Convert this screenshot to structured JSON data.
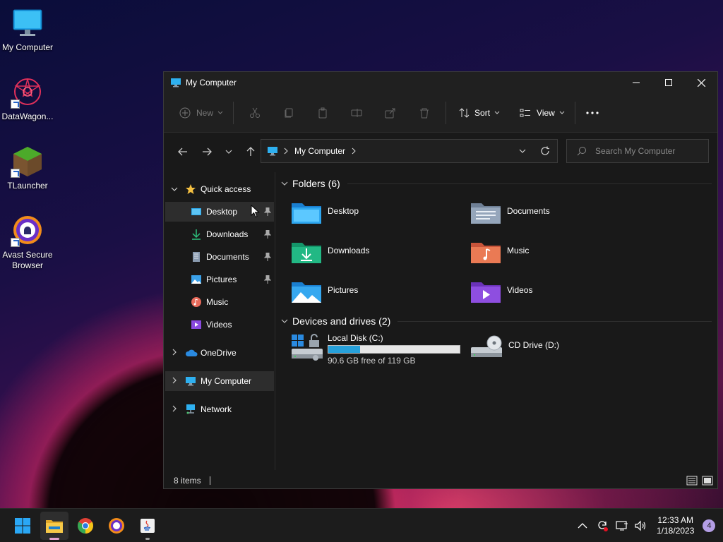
{
  "desktop": {
    "icons": [
      {
        "label": "My Computer"
      },
      {
        "label": "DataWagon..."
      },
      {
        "label": "TLauncher"
      },
      {
        "label": "Avast Secure Browser"
      }
    ]
  },
  "window": {
    "title": "My Computer",
    "toolbar": {
      "new_label": "New",
      "sort_label": "Sort",
      "view_label": "View"
    },
    "address": {
      "path": "My Computer"
    },
    "search": {
      "placeholder": "Search My Computer"
    },
    "sidebar": {
      "quick_access": "Quick access",
      "items": [
        {
          "label": "Desktop",
          "pinned": true
        },
        {
          "label": "Downloads",
          "pinned": true
        },
        {
          "label": "Documents",
          "pinned": true
        },
        {
          "label": "Pictures",
          "pinned": true
        },
        {
          "label": "Music",
          "pinned": false
        },
        {
          "label": "Videos",
          "pinned": false
        }
      ],
      "onedrive": "OneDrive",
      "my_computer": "My Computer",
      "network": "Network"
    },
    "content": {
      "folders_header": "Folders (6)",
      "folders": [
        {
          "label": "Desktop"
        },
        {
          "label": "Documents"
        },
        {
          "label": "Downloads"
        },
        {
          "label": "Music"
        },
        {
          "label": "Pictures"
        },
        {
          "label": "Videos"
        }
      ],
      "drives_header": "Devices and drives (2)",
      "drives": [
        {
          "label": "Local Disk (C:)",
          "free_text": "90.6 GB free of 119 GB",
          "used_fraction": 0.24
        },
        {
          "label": "CD Drive (D:)"
        }
      ]
    },
    "status": {
      "items_text": "8 items"
    }
  },
  "taskbar": {
    "time": "12:33 AM",
    "date": "1/18/2023",
    "notification_count": "4"
  },
  "colors": {
    "accent": "#0078d4",
    "folder_yellow": "#f5c142",
    "drive_bar": "#26a0da"
  }
}
